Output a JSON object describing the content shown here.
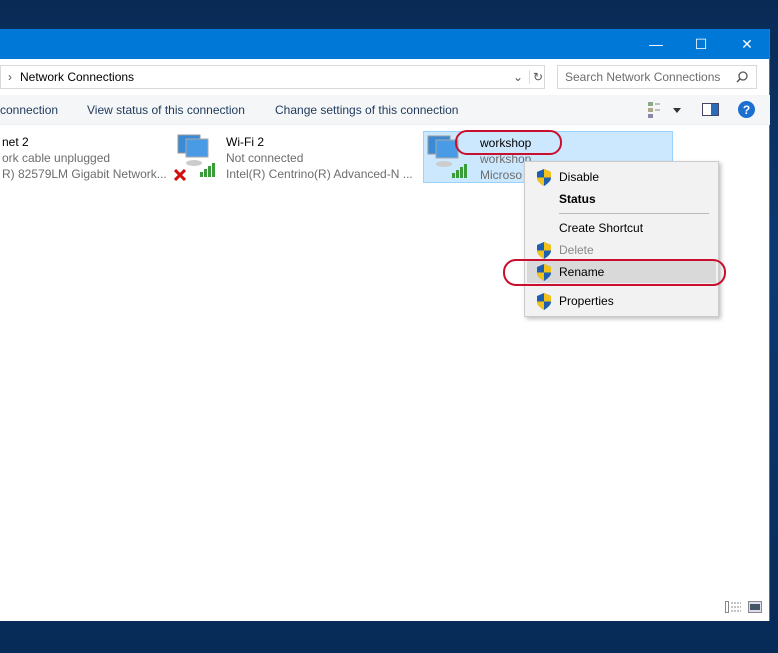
{
  "window": {
    "minimize": "—",
    "maximize": "☐",
    "close": "✕"
  },
  "address": {
    "separator": "›",
    "path": "Network Connections",
    "dropdown": "⌄",
    "refresh": "↻"
  },
  "search": {
    "placeholder": "Search Network Connections",
    "icon": "search-icon"
  },
  "commands": [
    "connection",
    "View status of this connection",
    "Change settings of this connection"
  ],
  "connections": [
    {
      "name": "net 2",
      "status": "ork cable unplugged",
      "adapter": "R) 82579LM Gigabit Network..."
    },
    {
      "name": "Wi-Fi 2",
      "status": "Not connected",
      "adapter": "Intel(R) Centrino(R) Advanced-N ..."
    },
    {
      "name": "workshop",
      "status": "workshop",
      "adapter": "Microso"
    }
  ],
  "context_menu": [
    {
      "label": "Disable",
      "shield": true
    },
    {
      "label": "Status",
      "bold": true
    },
    {
      "label": "Create Shortcut"
    },
    {
      "label": "Delete",
      "shield": true,
      "disabled": true
    },
    {
      "label": "Rename",
      "shield": true,
      "highlighted": true
    },
    {
      "label": "Properties",
      "shield": true
    }
  ],
  "colors": {
    "titlebar": "#0078d7",
    "selection": "#cce8ff",
    "highlight_ring": "#c8102e"
  }
}
